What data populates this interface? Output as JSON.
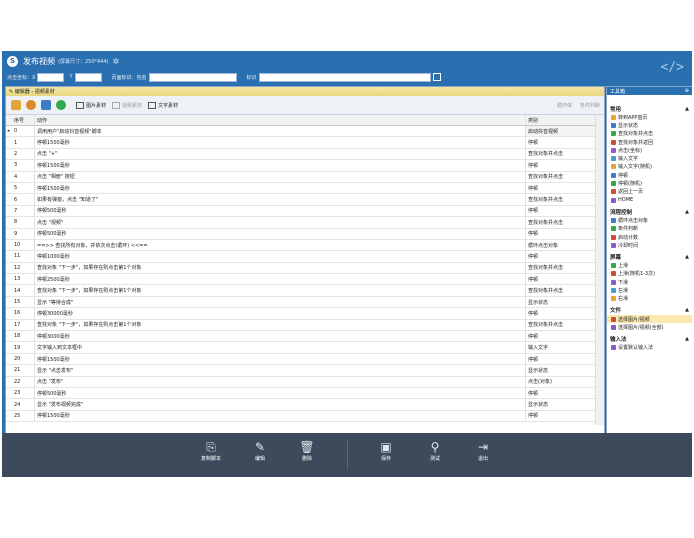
{
  "window": {
    "title": "发布视频",
    "subtitle": "(屏幕尺寸：250*444)"
  },
  "params": {
    "x_label": "点击坐标：X",
    "y_label": "Y",
    "page_label": "页面标识：包名",
    "id_label": "标识"
  },
  "editor": {
    "tab_title": "编辑器 - 视频素材",
    "tools": {
      "image": "图片素材",
      "video": "视频素材",
      "text": "文字素材"
    },
    "right": {
      "loop": "循环体",
      "cond": "条件判断"
    },
    "columns": [
      "序号",
      "动作",
      "类别"
    ],
    "rows": [
      {
        "n": "0",
        "action": "调用用户\"启动抖音视频\"脚本",
        "cat": "启动抖音视频"
      },
      {
        "n": "1",
        "action": "停顿1500毫秒",
        "cat": "停顿"
      },
      {
        "n": "2",
        "action": "点击 \"+\"",
        "cat": "查找对象并点击"
      },
      {
        "n": "3",
        "action": "停顿1500毫秒",
        "cat": "停顿"
      },
      {
        "n": "4",
        "action": "点击 \"相册\" 按钮",
        "cat": "查找对象并点击"
      },
      {
        "n": "5",
        "action": "停顿1500毫秒",
        "cat": "停顿"
      },
      {
        "n": "6",
        "action": "如果有弹窗，点击 \"知道了\"",
        "cat": "查找对象并点击"
      },
      {
        "n": "7",
        "action": "停顿500毫秒",
        "cat": "停顿"
      },
      {
        "n": "8",
        "action": "点击 \"视频\"",
        "cat": "查找对象并点击"
      },
      {
        "n": "9",
        "action": "停顿500毫秒",
        "cat": "停顿"
      },
      {
        "n": "10",
        "action": "==>> 查找所有对象，并依次点击(循环) <<==",
        "cat": "循环点击对象"
      },
      {
        "n": "11",
        "action": "停顿1000毫秒",
        "cat": "停顿"
      },
      {
        "n": "12",
        "action": "查找对象 \"下一步\"，如果存在则点击第1个对象",
        "cat": "查找对象并点击"
      },
      {
        "n": "13",
        "action": "停顿2500毫秒",
        "cat": "停顿"
      },
      {
        "n": "14",
        "action": "查找对象 \"下一步\"，如果存在则点击第1个对象",
        "cat": "查找对象并点击"
      },
      {
        "n": "15",
        "action": "显示 \"等待合成\"",
        "cat": "显示状态"
      },
      {
        "n": "16",
        "action": "停顿30000毫秒",
        "cat": "停顿"
      },
      {
        "n": "17",
        "action": "查找对象 \"下一步\"，如果存在则点击第1个对象",
        "cat": "查找对象并点击"
      },
      {
        "n": "18",
        "action": "停顿3000毫秒",
        "cat": "停顿"
      },
      {
        "n": "19",
        "action": "文字输入到文本框中",
        "cat": "输入文字"
      },
      {
        "n": "20",
        "action": "停顿1500毫秒",
        "cat": "停顿"
      },
      {
        "n": "21",
        "action": "显示 \"点击发布\"",
        "cat": "显示状态"
      },
      {
        "n": "22",
        "action": "点击 \"发布\"",
        "cat": "点击(对象)"
      },
      {
        "n": "23",
        "action": "停顿500毫秒",
        "cat": "停顿"
      },
      {
        "n": "24",
        "action": "显示 \"发布视频完成\"",
        "cat": "显示状态"
      },
      {
        "n": "25",
        "action": "停顿1500毫秒",
        "cat": "停顿"
      }
    ]
  },
  "bottom": {
    "copy": "复制脚本",
    "edit": "编辑",
    "delete": "删除",
    "save": "保存",
    "test": "测试",
    "exit": "退出"
  },
  "panel": {
    "title": "工具箱",
    "sections": [
      {
        "name": "常用",
        "items": [
          "转到APP首页",
          "显示状态",
          "查找对象并点击",
          "查找对象并返回",
          "点击(坐标)",
          "输入文字",
          "输入文字(随机)",
          "停顿",
          "停顿(随机)",
          "返回上一页",
          "HOME"
        ]
      },
      {
        "name": "流程控制",
        "items": [
          "循环点击对象",
          "条件判断",
          "启动计数",
          "冷却时间"
        ]
      },
      {
        "name": "屏幕",
        "items": [
          "上滑",
          "上滑(随机1-3次)",
          "下滑",
          "左滑",
          "右滑"
        ]
      },
      {
        "name": "文件",
        "items": [
          "选择图片/视频",
          "选择图片/视频(全部)"
        ]
      },
      {
        "name": "输入法",
        "items": [
          "设置默认输入法"
        ]
      }
    ]
  },
  "colors": {
    "titlebar": "#2a6fb0",
    "bottombar": "#3d4a5c",
    "highlight": "#fbe9b0"
  }
}
